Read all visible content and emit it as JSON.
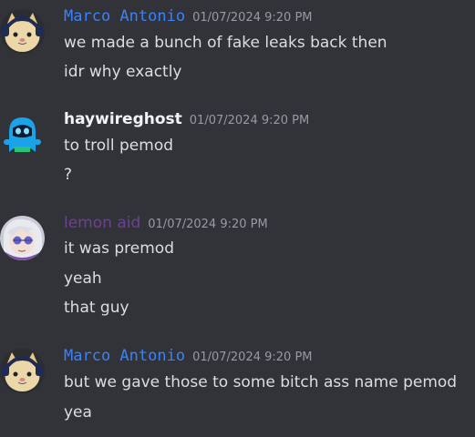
{
  "colors": {
    "background": "#323339",
    "text": "#dbdee1",
    "timestamp": "#949ba4",
    "marco_name": "#3b82f6",
    "haywire_name": "#f2f3f5",
    "lemon_name": "#6f3f94"
  },
  "messages": [
    {
      "author": "Marco Antonio",
      "timestamp": "01/07/2024 9:20 PM",
      "avatar_icon": "cat-headphones-avatar-icon",
      "lines": [
        "we made a bunch of fake leaks back then",
        "idr why exactly"
      ]
    },
    {
      "author": "haywireghost",
      "timestamp": "01/07/2024 9:20 PM",
      "avatar_icon": "blue-ghost-avatar-icon",
      "lines": [
        "to troll pemod",
        "?"
      ]
    },
    {
      "author": "lemon aid",
      "timestamp": "01/07/2024 9:20 PM",
      "avatar_icon": "anime-character-avatar-icon",
      "lines": [
        "it was premod",
        "yeah",
        "that guy"
      ]
    },
    {
      "author": "Marco Antonio",
      "timestamp": "01/07/2024 9:20 PM",
      "avatar_icon": "cat-headphones-avatar-icon",
      "lines": [
        "but we gave those to some bitch ass name pemod",
        "yea"
      ]
    }
  ]
}
